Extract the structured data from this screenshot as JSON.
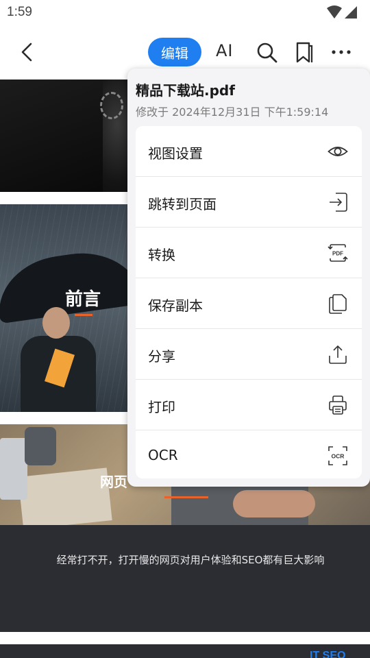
{
  "status_bar": {
    "time": "1:59"
  },
  "toolbar": {
    "edit_label": "编辑",
    "ai_label": "AI"
  },
  "document": {
    "section_title_1": "前言",
    "section_title_2": "网页",
    "footer_text": "经常打不开，打开慢的网页对用户体验和SEO都有巨大影响",
    "logo_fragment": "IT SEO"
  },
  "menu": {
    "file_name": "精品下载站.pdf",
    "modified": "修改于 2024年12月31日 下午1:59:14",
    "items": [
      {
        "label": "视图设置",
        "icon": "eye-icon"
      },
      {
        "label": "跳转到页面",
        "icon": "goto-page-icon"
      },
      {
        "label": "转换",
        "icon": "convert-pdf-icon"
      },
      {
        "label": "保存副本",
        "icon": "copy-icon"
      },
      {
        "label": "分享",
        "icon": "share-icon"
      },
      {
        "label": "打印",
        "icon": "printer-icon"
      },
      {
        "label": "OCR",
        "icon": "ocr-icon"
      }
    ],
    "icon_pdf_text": "PDF",
    "icon_ocr_text": "OCR"
  },
  "colors": {
    "accent": "#1f7ff0",
    "underline": "#e8622c",
    "footer_bg": "#2b2d33"
  }
}
